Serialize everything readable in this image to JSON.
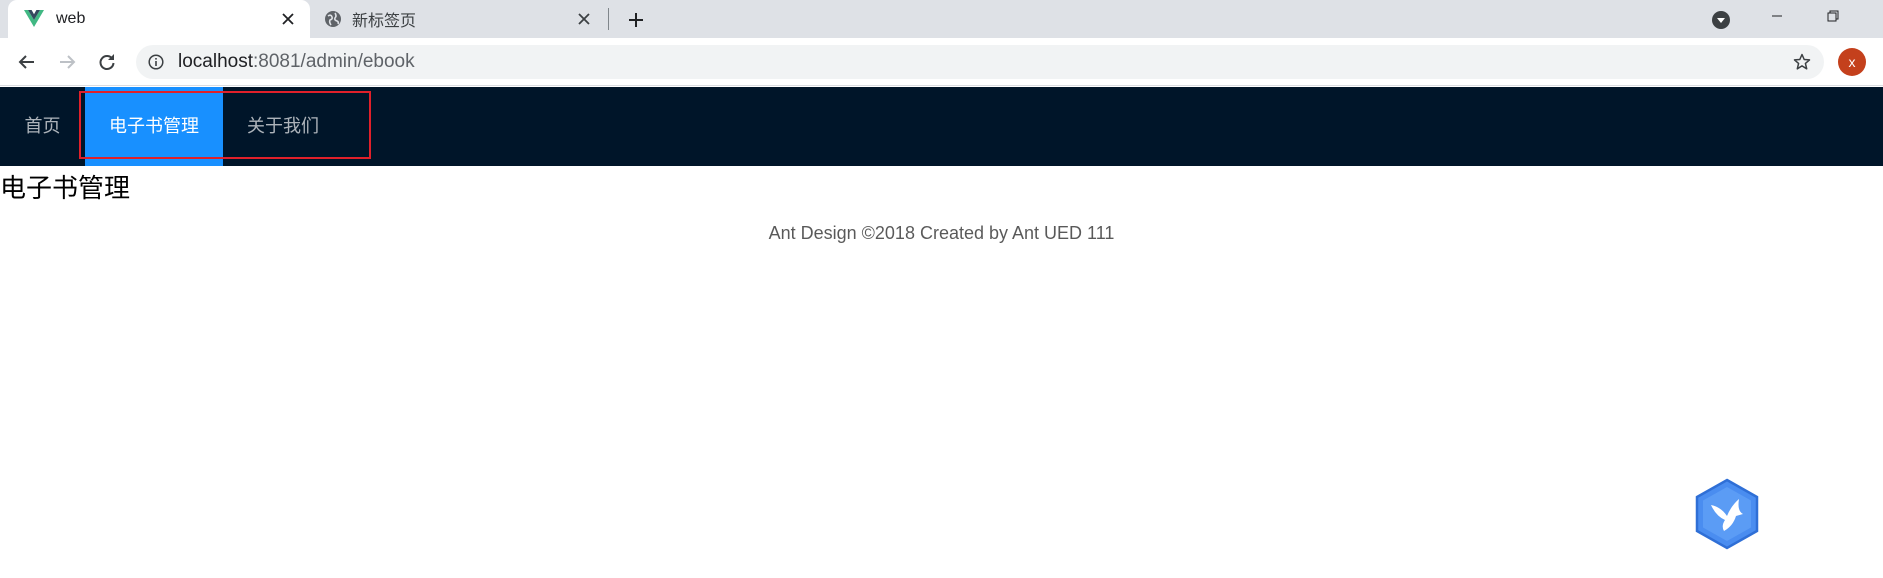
{
  "browser": {
    "tabs": [
      {
        "title": "web",
        "icon": "vue-logo-icon",
        "active": true
      },
      {
        "title": "新标签页",
        "icon": "globe-icon",
        "active": false
      }
    ],
    "url": {
      "host": "localhost",
      "path": ":8081/admin/ebook"
    },
    "profile_initial": "x"
  },
  "header": {
    "menu": [
      {
        "label": "首页",
        "selected": false
      },
      {
        "label": "电子书管理",
        "selected": true
      },
      {
        "label": "关于我们",
        "selected": false
      }
    ]
  },
  "main": {
    "title": "电子书管理"
  },
  "footer": {
    "text": "Ant Design ©2018 Created by Ant UED 111"
  },
  "colors": {
    "header_bg": "#001529",
    "menu_selected_bg": "#1890ff",
    "annotation_box": "#e0202a",
    "float_button": "#4a8df0"
  }
}
